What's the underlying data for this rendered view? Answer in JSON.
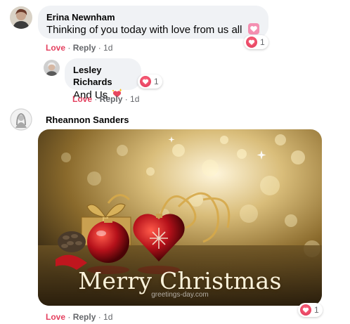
{
  "comments": [
    {
      "author": "Erina Newnham",
      "text": "Thinking of you today with love from us all",
      "emoji": "heart-emoji",
      "actions": {
        "love": "Love",
        "reply": "Reply",
        "sep": " · ",
        "time": "1d"
      },
      "reactions": {
        "type": "love-reaction",
        "count": "1"
      }
    },
    {
      "author": "Lesley Richards",
      "text": "And Us.",
      "emoji": "sparkling-heart-emoji",
      "actions": {
        "love": "Love",
        "reply": "Reply",
        "sep": " · ",
        "time": "1d"
      },
      "reactions": {
        "type": "love-reaction",
        "count": "1"
      }
    },
    {
      "author": "Rheannon Sanders",
      "media": {
        "type": "christmas-greeting-gif",
        "caption": "Merry Christmas",
        "watermark": "greetings-day.com"
      },
      "actions": {
        "love": "Love",
        "reply": "Reply",
        "sep": " · ",
        "time": "1d"
      },
      "reactions": {
        "type": "love-reaction",
        "count": "1"
      }
    }
  ],
  "colors": {
    "bubble": "#f0f2f5",
    "love_text": "#e4405f",
    "meta_text": "#65676b",
    "name_text": "#050505"
  }
}
